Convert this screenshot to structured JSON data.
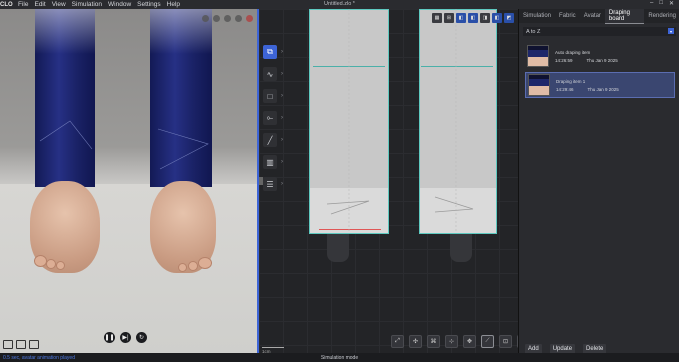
{
  "app": {
    "logo": "CLO",
    "title": "Untitled.zlo *",
    "menus": [
      "File",
      "Edit",
      "View",
      "Simulation",
      "Window",
      "Settings",
      "Help"
    ],
    "window_controls": [
      "–",
      "□",
      "✕"
    ]
  },
  "viewport3d": {
    "playback": {
      "pause": "❚❚",
      "next": "▶|",
      "reset": "↻"
    }
  },
  "viewport2d": {
    "scale_label": "1cm",
    "tools": [
      "select",
      "curve",
      "rectangle",
      "sewing",
      "segment",
      "fold",
      "layer"
    ]
  },
  "panel": {
    "tabs": [
      "Simulation",
      "Fabric",
      "Avatar",
      "Draping board",
      "Rendering"
    ],
    "active_tab": "Draping board",
    "sort": "A to Z",
    "items": [
      {
        "name": "Auto draping item",
        "time": "14:26:59",
        "date": "Thu Jan 9 2025"
      },
      {
        "name": "Draping item 1",
        "time": "14:29:46",
        "date": "Thu Jan 9 2025"
      }
    ],
    "buttons": {
      "add": "Add",
      "update": "Update",
      "delete": "Delete"
    }
  },
  "status": {
    "left": "0.5 sec, avatar animation played",
    "center": "Simulation mode"
  },
  "colors": {
    "accent": "#3d64d6",
    "seam": "#5ec9c0",
    "denim": "#1f2870"
  }
}
